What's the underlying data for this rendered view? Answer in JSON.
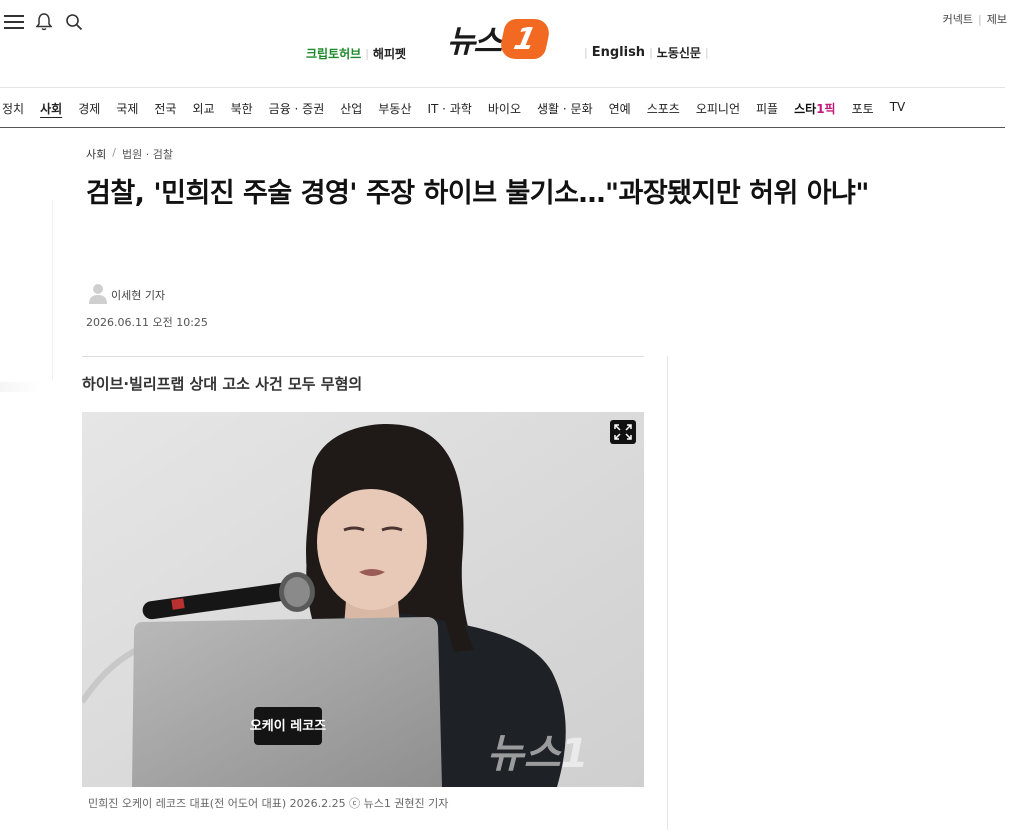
{
  "header": {
    "icons": [
      "menu-icon",
      "bell-icon",
      "search-icon"
    ],
    "right_links": [
      "커넥트",
      "제보"
    ],
    "logo_text": "뉴스",
    "logo_number": "1",
    "sub_left": [
      "크립토허브",
      "해피펫"
    ],
    "sub_right": [
      "English",
      "노동신문"
    ]
  },
  "nav": {
    "items": [
      "정치",
      "사회",
      "경제",
      "국제",
      "전국",
      "외교",
      "북한",
      "금융 · 증권",
      "산업",
      "부동산",
      "IT · 과학",
      "바이오",
      "생활 · 문화",
      "연예",
      "스포츠",
      "오피니언",
      "피플",
      "스타1픽",
      "포토",
      "TV"
    ],
    "active": "사회"
  },
  "article": {
    "breadcrumb_section": "사회",
    "breadcrumb_sep": "/",
    "breadcrumb_sub": "법원 · 검찰",
    "title": "검찰, '민희진 주술 경영' 주장 하이브 불기소…\"과장됐지만 허위 아냐\"",
    "author": "이세현 기자",
    "date": "2026.06.11 오전 10:25",
    "subtitle": "하이브·빌리프랩 상대 고소 사건 모두 무혐의",
    "photo_laptop_sticker": "오케이 레코즈",
    "photo_watermark": "뉴스1",
    "caption": "민희진 오케이 레코즈 대표(전 어도어 대표) 2026.2.25 ⓒ 뉴스1 권현진 기자"
  },
  "colors": {
    "brand_orange": "#f26a21",
    "crypto_green": "#1d8a2b",
    "star_pink": "#c2187a"
  }
}
